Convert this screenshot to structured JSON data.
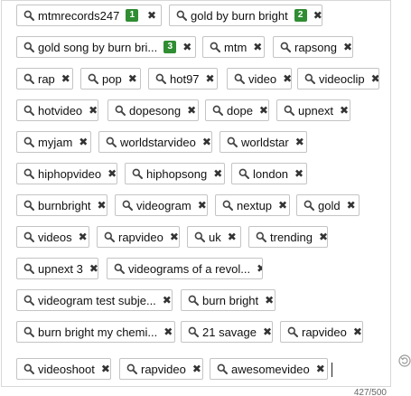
{
  "tags": [
    {
      "label": "mtmrecords247",
      "badge": "1"
    },
    {
      "label": "gold by burn bright",
      "badge": "2"
    },
    {
      "label": "gold song by burn bri...",
      "badge": "3"
    },
    {
      "label": "mtm"
    },
    {
      "label": "rapsong"
    },
    {
      "label": "rap"
    },
    {
      "label": "pop"
    },
    {
      "label": "hot97"
    },
    {
      "label": "video"
    },
    {
      "label": "videoclip"
    },
    {
      "label": "hotvideo"
    },
    {
      "label": "dopesong"
    },
    {
      "label": "dope"
    },
    {
      "label": "upnext"
    },
    {
      "label": "myjam"
    },
    {
      "label": "worldstarvideo"
    },
    {
      "label": "worldstar"
    },
    {
      "label": "hiphopvideo"
    },
    {
      "label": "hiphopsong"
    },
    {
      "label": "london"
    },
    {
      "label": "burnbright"
    },
    {
      "label": "videogram"
    },
    {
      "label": "nextup"
    },
    {
      "label": "gold"
    },
    {
      "label": "videos"
    },
    {
      "label": "rapvideo"
    },
    {
      "label": "uk"
    },
    {
      "label": "trending"
    },
    {
      "label": "upnext 3"
    },
    {
      "label": "videograms of a revol..."
    },
    {
      "label": "videogram test subje..."
    },
    {
      "label": "burn bright"
    },
    {
      "label": "burn bright my chemi..."
    },
    {
      "label": "21 savage"
    },
    {
      "label": "rapvideo"
    },
    {
      "label": "videoshoot"
    },
    {
      "label": "rapvideo"
    },
    {
      "label": "awesomevideo"
    }
  ],
  "remove_glyph": "✖",
  "icons": {
    "tag_icon": "magnifier-icon",
    "refresh_icon": "refresh-icon"
  },
  "counter": "427/500",
  "colors": {
    "badge": "#2f8d32",
    "chip_border": "#c4c4c4",
    "box_border": "#d8d8d8"
  }
}
